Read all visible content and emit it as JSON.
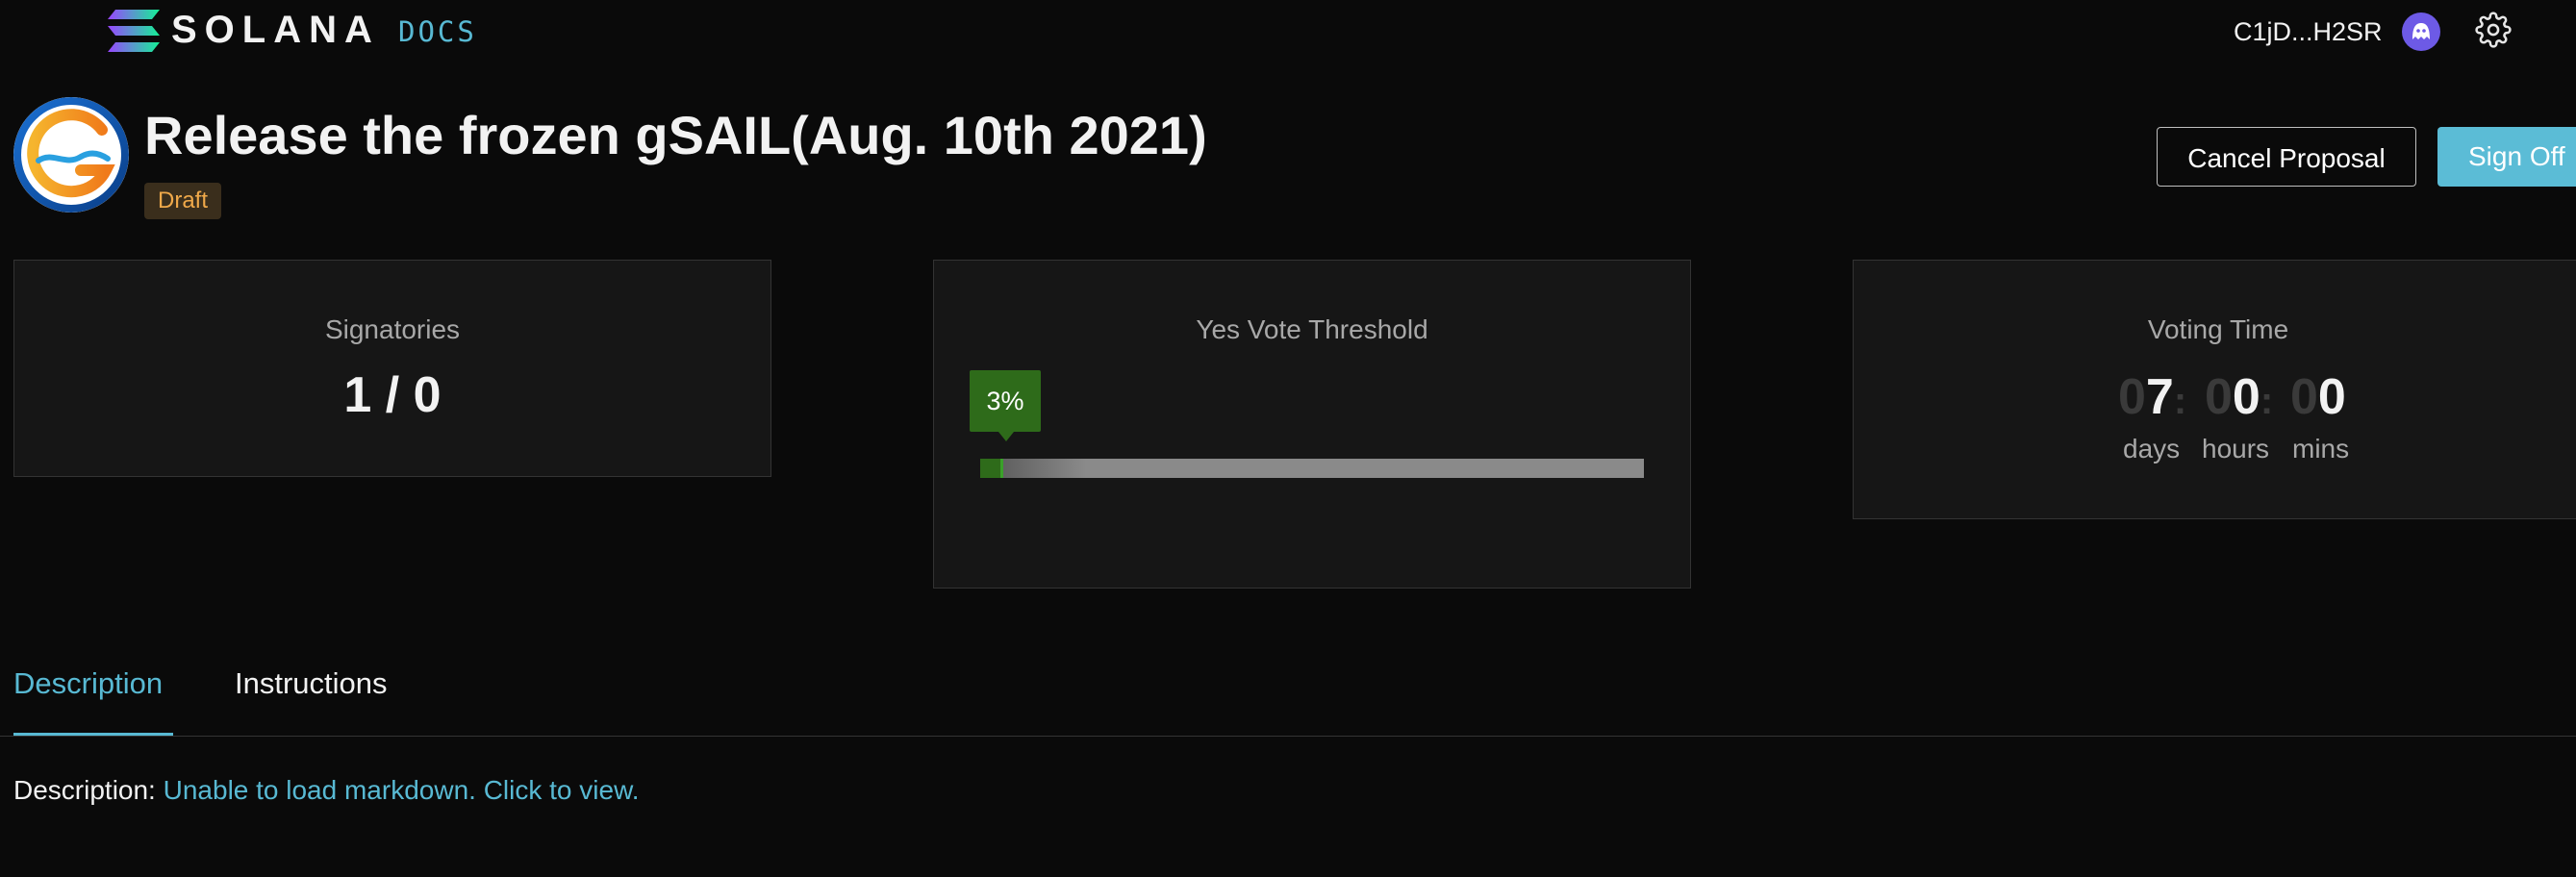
{
  "header": {
    "brand": "SOLANA",
    "docs_label": "DOCS",
    "wallet_address": "C1jD...H2SR",
    "avatar_icon": "ghost-avatar-icon",
    "settings_icon": "gear-icon"
  },
  "proposal": {
    "title": "Release the frozen gSAIL(Aug. 10th 2021)",
    "status": "Draft",
    "cancel_label": "Cancel Proposal",
    "sign_label": "Sign Off"
  },
  "cards": {
    "signatories": {
      "label": "Signatories",
      "value": "1 / 0"
    },
    "threshold": {
      "label": "Yes Vote Threshold",
      "value_label": "3%",
      "fraction": 0.03
    },
    "voting_time": {
      "label": "Voting Time",
      "days_prefix": "0",
      "days": "7",
      "hours_prefix": "0",
      "hours": "0",
      "mins_prefix": "0",
      "mins": "0",
      "sep": ":",
      "days_label": "days",
      "hours_label": "hours",
      "mins_label": "mins"
    }
  },
  "tabs": [
    {
      "label": "Description",
      "active": true
    },
    {
      "label": "Instructions",
      "active": false
    }
  ],
  "description": {
    "prefix": "Description: ",
    "link_text": "Unable to load markdown. Click to view."
  },
  "colors": {
    "accent": "#58b9d3",
    "draft": "#f0a94a",
    "threshold": "#2e6b1a"
  }
}
